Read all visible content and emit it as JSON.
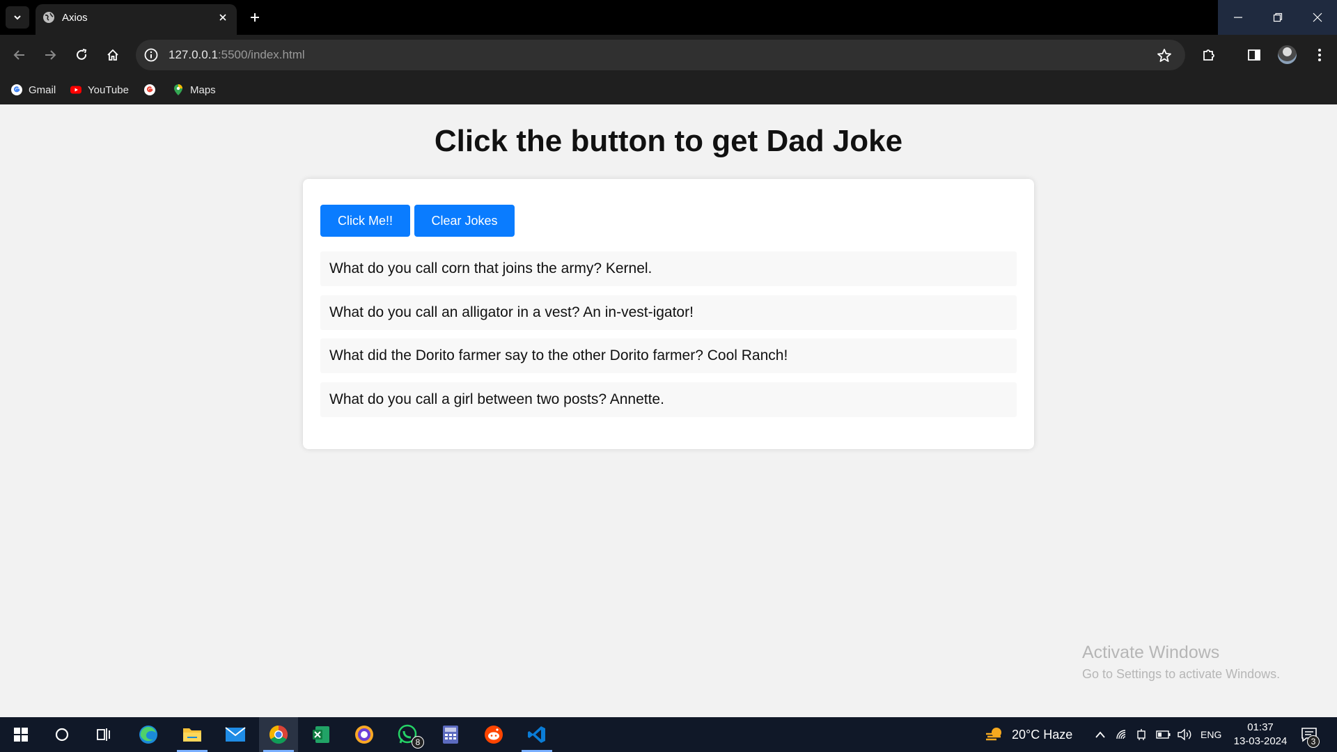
{
  "browser": {
    "tab_title": "Axios",
    "url_host": "127.0.0.1",
    "url_path": ":5500/index.html",
    "bookmarks": [
      {
        "label": "Gmail",
        "icon": "google-icon"
      },
      {
        "label": "YouTube",
        "icon": "youtube-icon"
      },
      {
        "label": "",
        "icon": "google-icon"
      },
      {
        "label": "Maps",
        "icon": "maps-icon"
      }
    ]
  },
  "page": {
    "title": "Click the button to get Dad Joke",
    "get_button": "Click Me!!",
    "clear_button": "Clear Jokes",
    "jokes": [
      "What do you call corn that joins the army? Kernel.",
      "What do you call an alligator in a vest? An in-vest-igator!",
      "What did the Dorito farmer say to the other Dorito farmer? Cool Ranch!",
      "What do you call a girl between two posts? Annette."
    ],
    "accent_color": "#0a7cff"
  },
  "watermark": {
    "line1": "Activate Windows",
    "line2": "Go to Settings to activate Windows."
  },
  "taskbar": {
    "weather": "20°C  Haze",
    "language": "ENG",
    "time": "01:37",
    "date": "13-03-2024",
    "whatsapp_badge": "8",
    "notification_badge": "3"
  }
}
